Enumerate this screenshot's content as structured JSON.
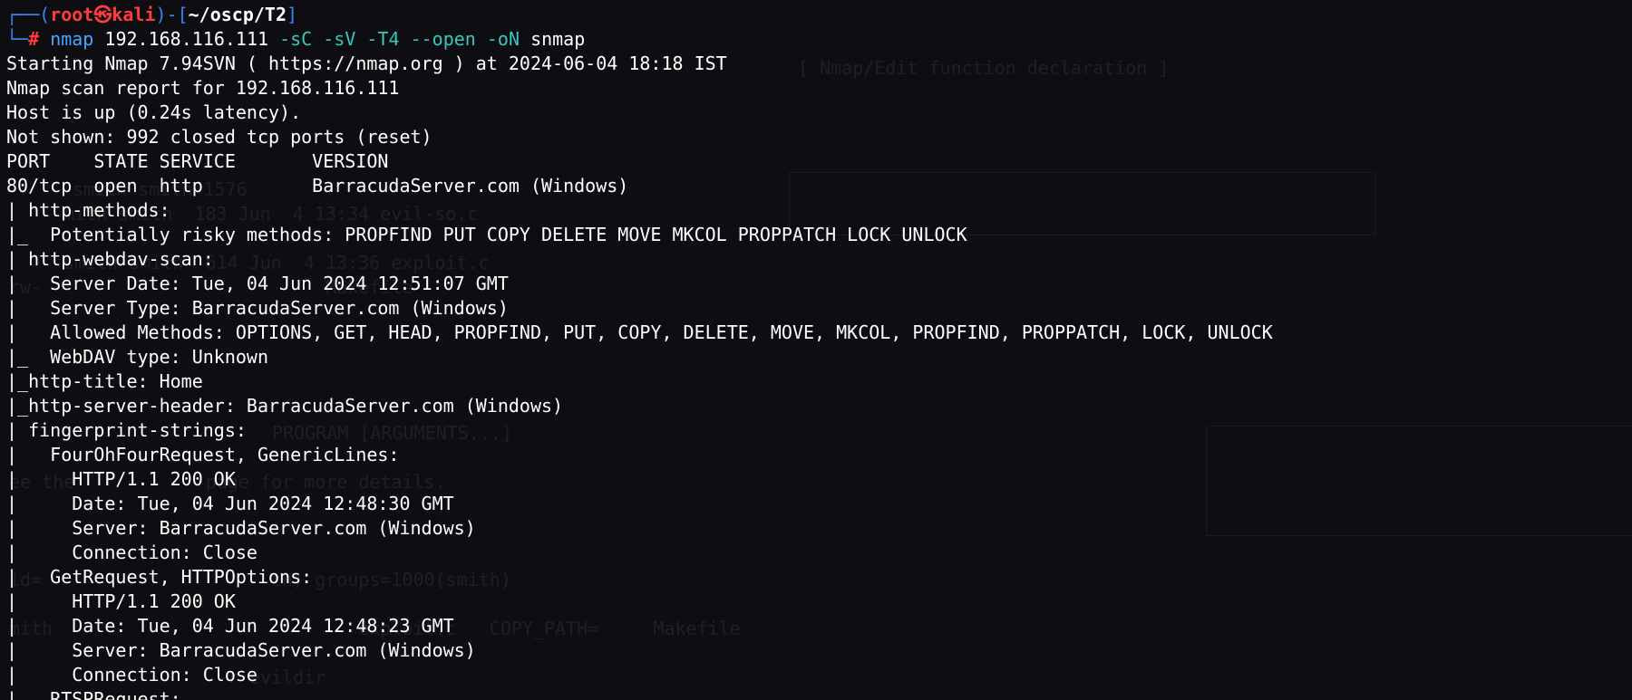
{
  "prompt": {
    "frame_open": "┌──(",
    "user": "root㉿kali",
    "frame_mid": ")-[",
    "cwd": "~/oscp/T2",
    "frame_close": "]",
    "frame_lower": "└─",
    "symbol": "#",
    "command": "nmap",
    "ip": "192.168.116.111",
    "flag_sc": "-sC",
    "flag_sv": "-sV",
    "flag_t4": "-T4",
    "flag_open": "--open",
    "flag_on": "-oN",
    "output_file": "snmap"
  },
  "output": [
    "Starting Nmap 7.94SVN ( https://nmap.org ) at 2024-06-04 18:18 IST",
    "Nmap scan report for 192.168.116.111",
    "Host is up (0.24s latency).",
    "Not shown: 992 closed tcp ports (reset)",
    "PORT    STATE SERVICE       VERSION",
    "80/tcp  open  http          BarracudaServer.com (Windows)",
    "| http-methods:",
    "|_  Potentially risky methods: PROPFIND PUT COPY DELETE MOVE MKCOL PROPPATCH LOCK UNLOCK",
    "| http-webdav-scan:",
    "|   Server Date: Tue, 04 Jun 2024 12:51:07 GMT",
    "|   Server Type: BarracudaServer.com (Windows)",
    "|   Allowed Methods: OPTIONS, GET, HEAD, PROPFIND, PUT, COPY, DELETE, MOVE, MKCOL, PROPFIND, PROPPATCH, LOCK, UNLOCK",
    "|_  WebDAV type: Unknown",
    "|_http-title: Home",
    "|_http-server-header: BarracudaServer.com (Windows)",
    "| fingerprint-strings:",
    "|   FourOhFourRequest, GenericLines:",
    "|     HTTP/1.1 200 OK",
    "|     Date: Tue, 04 Jun 2024 12:48:30 GMT",
    "|     Server: BarracudaServer.com (Windows)",
    "|     Connection: Close",
    "|   GetRequest, HTTPOptions:",
    "|     HTTP/1.1 200 OK",
    "|     Date: Tue, 04 Jun 2024 12:48:23 GMT",
    "|     Server: BarracudaServer.com (Windows)",
    "|     Connection: Close",
    "|   RTSPRequest:"
  ],
  "background_ghost": [
    "[ Nmap/Edit function declaration ]",
    "smith smith 1576",
    "mith smith  183 Jun  4 13:34 evil-so.c",
    "smith smith  614 Jun  4 13:36 exploit.c",
    "rw-                          Makefile",
    "PROGRAM [ARGUMENTS...]",
    "ee the            page for more details.",
    "id=                     th) groups=1000(smith)",
    "mith                            exploit.c   COPY_PATH=     Makefile",
    "                   -r evildir"
  ],
  "colors": {
    "background": "#0e0e12",
    "frame": "#3b82f6",
    "user": "#ff3b3b",
    "command": "#4aa3ff",
    "flag": "#38c7bd",
    "text": "#ffffff"
  }
}
